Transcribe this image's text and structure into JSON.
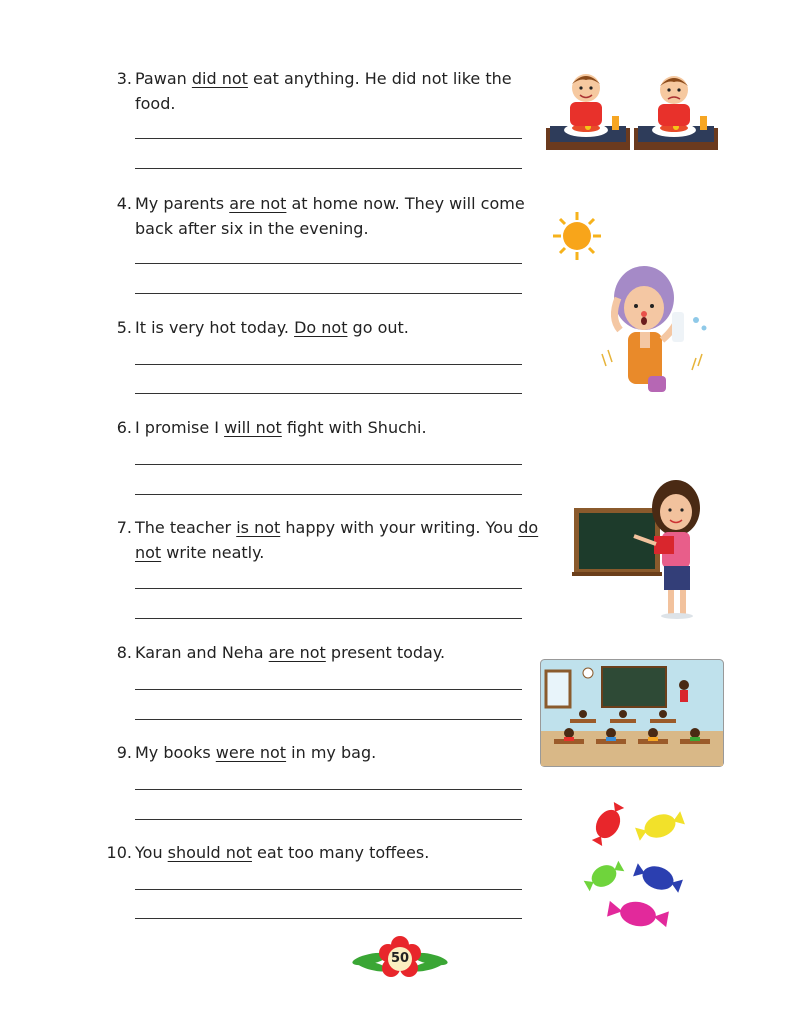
{
  "questions": [
    {
      "num": "3.",
      "pre": "Pawan ",
      "u1": "did not",
      "mid": " eat anything. He did not like the",
      "l2pre": "food.",
      "u2": "",
      "l2post": ""
    },
    {
      "num": "4.",
      "pre": "My parents ",
      "u1": "are not",
      "mid": " at home now. They will come",
      "l2pre": "back after six in the evening.",
      "u2": "",
      "l2post": ""
    },
    {
      "num": "5.",
      "pre": "It is very hot today. ",
      "u1": "Do not",
      "mid": " go out.",
      "l2pre": "",
      "u2": "",
      "l2post": ""
    },
    {
      "num": "6.",
      "pre": "I promise I ",
      "u1": "will not",
      "mid": " fight with Shuchi.",
      "l2pre": "",
      "u2": "",
      "l2post": ""
    },
    {
      "num": "7.",
      "pre": "The teacher ",
      "u1": "is not",
      "mid": " happy with your writing. You ",
      "u1b": "do",
      "l2pre": "",
      "u2": "not",
      "l2post": " write neatly."
    },
    {
      "num": "8.",
      "pre": "Karan and Neha ",
      "u1": "are not",
      "mid": " present today.",
      "l2pre": "",
      "u2": "",
      "l2post": ""
    },
    {
      "num": "9.",
      "pre": "My books ",
      "u1": "were not",
      "mid": " in my bag.",
      "l2pre": "",
      "u2": "",
      "l2post": ""
    },
    {
      "num": "10.",
      "pre": "You ",
      "u1": "should not",
      "mid": " eat too many toffees.",
      "l2pre": "",
      "u2": "",
      "l2post": ""
    }
  ],
  "page_number": "50",
  "colors": {
    "text": "#222222",
    "flower_red": "#e8262b",
    "leaf_green": "#3aa635"
  }
}
